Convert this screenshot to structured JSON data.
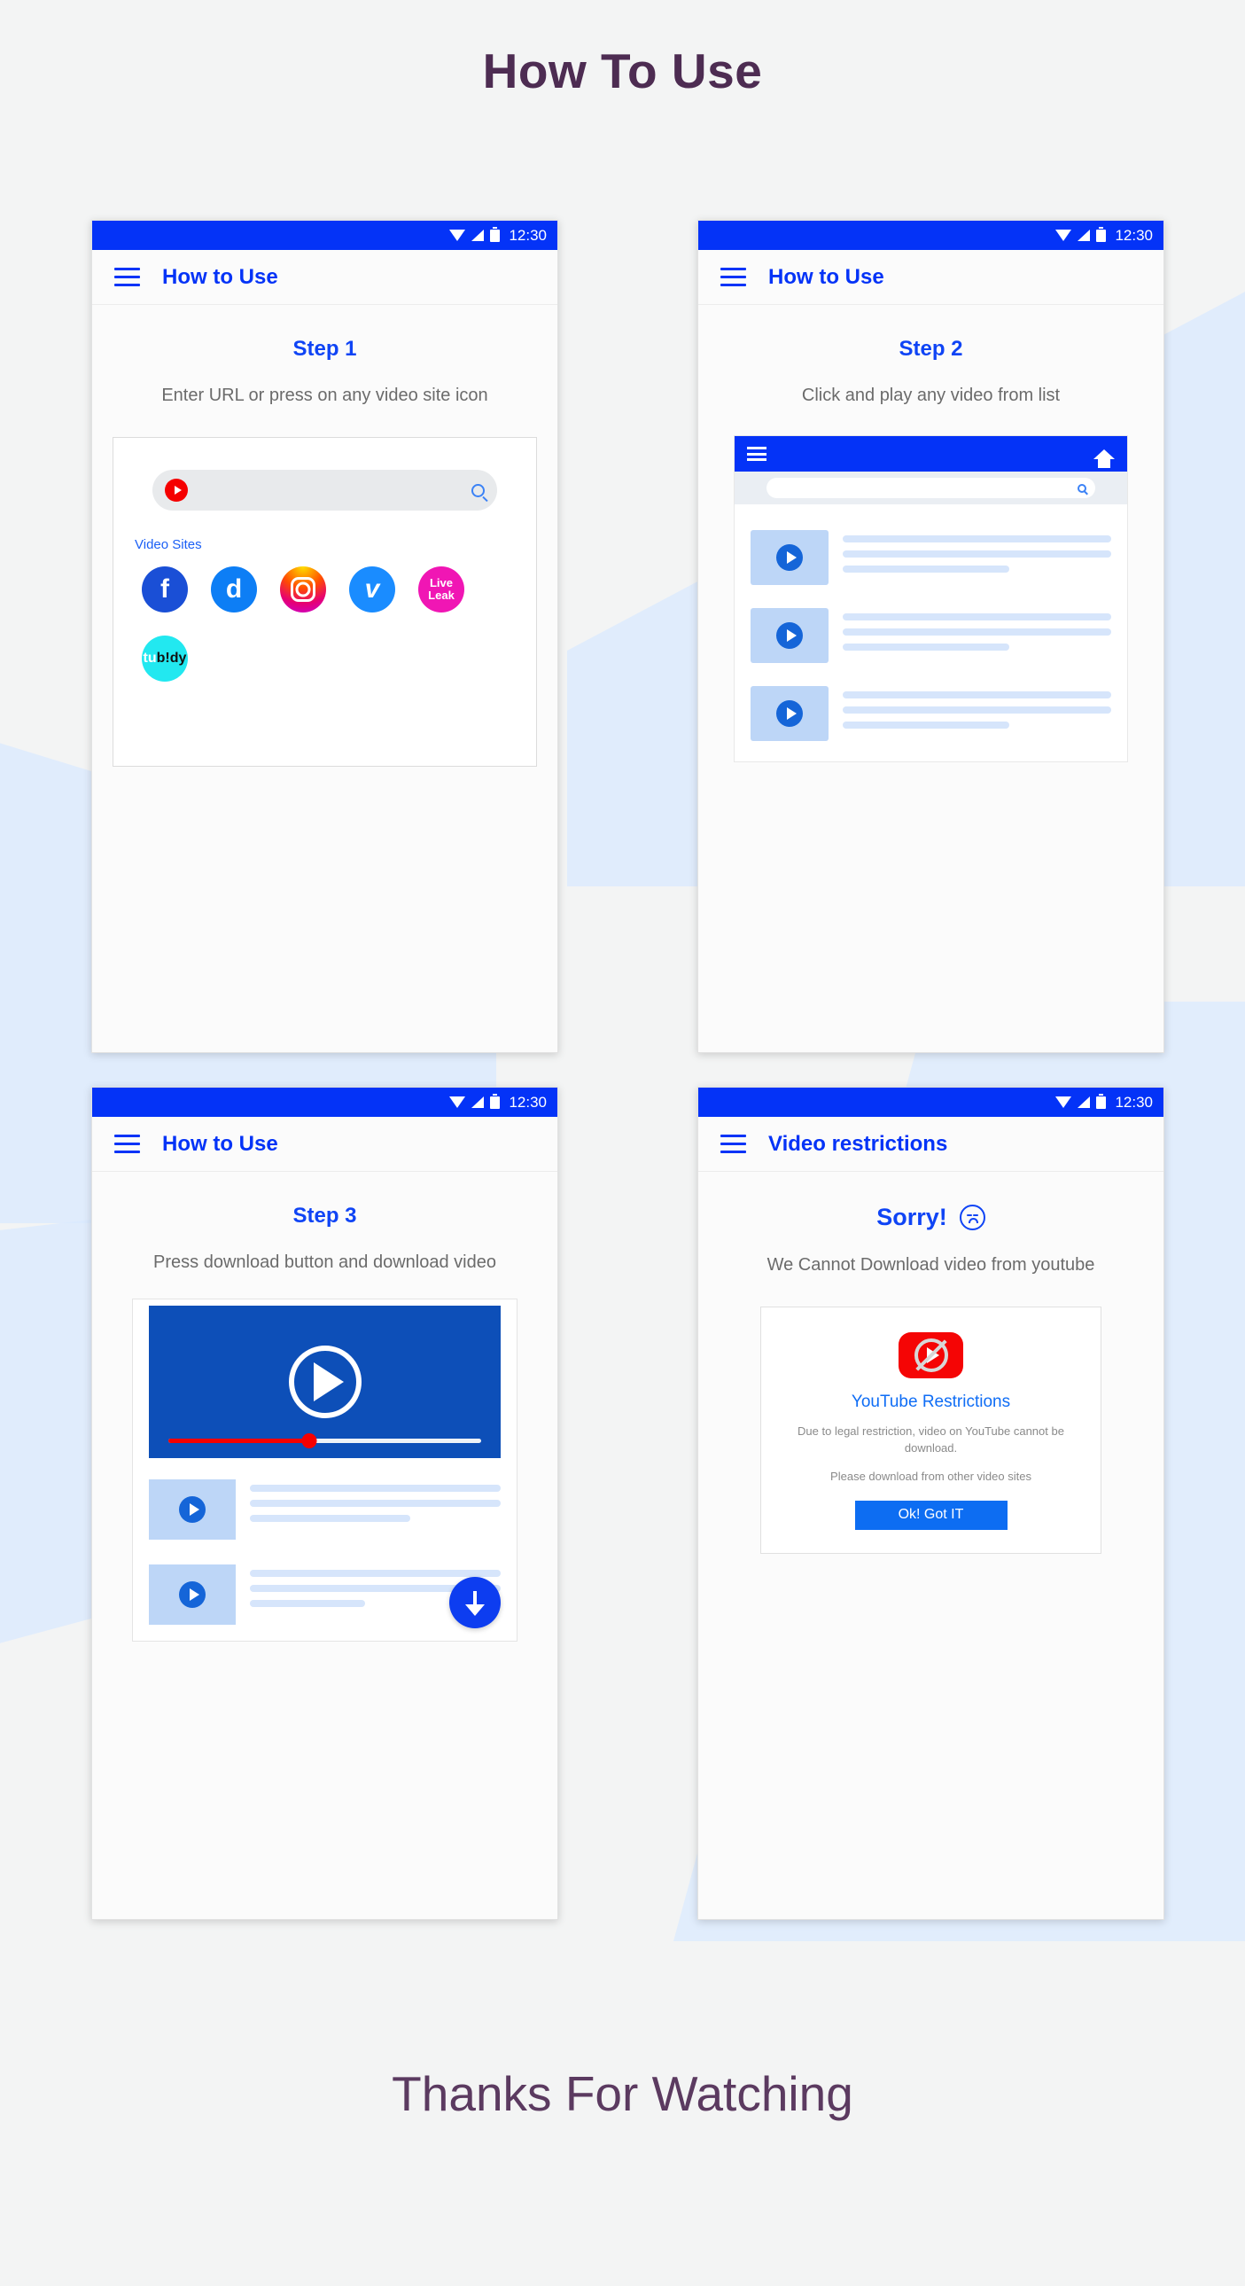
{
  "headline": "How To Use",
  "footer": "Thanks For Watching",
  "colors": {
    "accent_blue": "#0433f7",
    "title_purple": "#4d2c52",
    "red": "#f50000",
    "thumb_blue": "#bdd6f7",
    "player_blue": "#0d4fb8"
  },
  "status_bar": {
    "time": "12:30"
  },
  "screens": [
    {
      "id": "step1",
      "appbar_title": "How to Use",
      "step_title": "Step 1",
      "step_desc": "Enter URL or press on  any video site icon",
      "search_placeholder": "",
      "video_sites_label": "Video Sites",
      "video_sites": [
        {
          "name": "facebook",
          "glyph": "f"
        },
        {
          "name": "dailymotion",
          "glyph": "d"
        },
        {
          "name": "instagram",
          "glyph": ""
        },
        {
          "name": "vimeo",
          "glyph": "v"
        },
        {
          "name": "liveleak",
          "glyph": "Live\nLeak"
        },
        {
          "name": "tubidy",
          "glyph": "tubidy"
        }
      ]
    },
    {
      "id": "step2",
      "appbar_title": "How to Use",
      "step_title": "Step 2",
      "step_desc": "Click and play any video from list",
      "mini_search_placeholder": "",
      "list_rows": 3
    },
    {
      "id": "step3",
      "appbar_title": "How to Use",
      "step_title": "Step 3",
      "step_desc": "Press download button and download video",
      "progress_percent": 45,
      "list_rows": 2
    },
    {
      "id": "restrictions",
      "appbar_title": "Video restrictions",
      "sorry_title": "Sorry!",
      "sorry_desc": "We Cannot Download video from youtube",
      "dialog": {
        "title": "YouTube Restrictions",
        "body": "Due to legal restriction, video on YouTube cannot be download.",
        "body2": "Please download from other video sites",
        "button": "Ok! Got IT"
      }
    }
  ]
}
